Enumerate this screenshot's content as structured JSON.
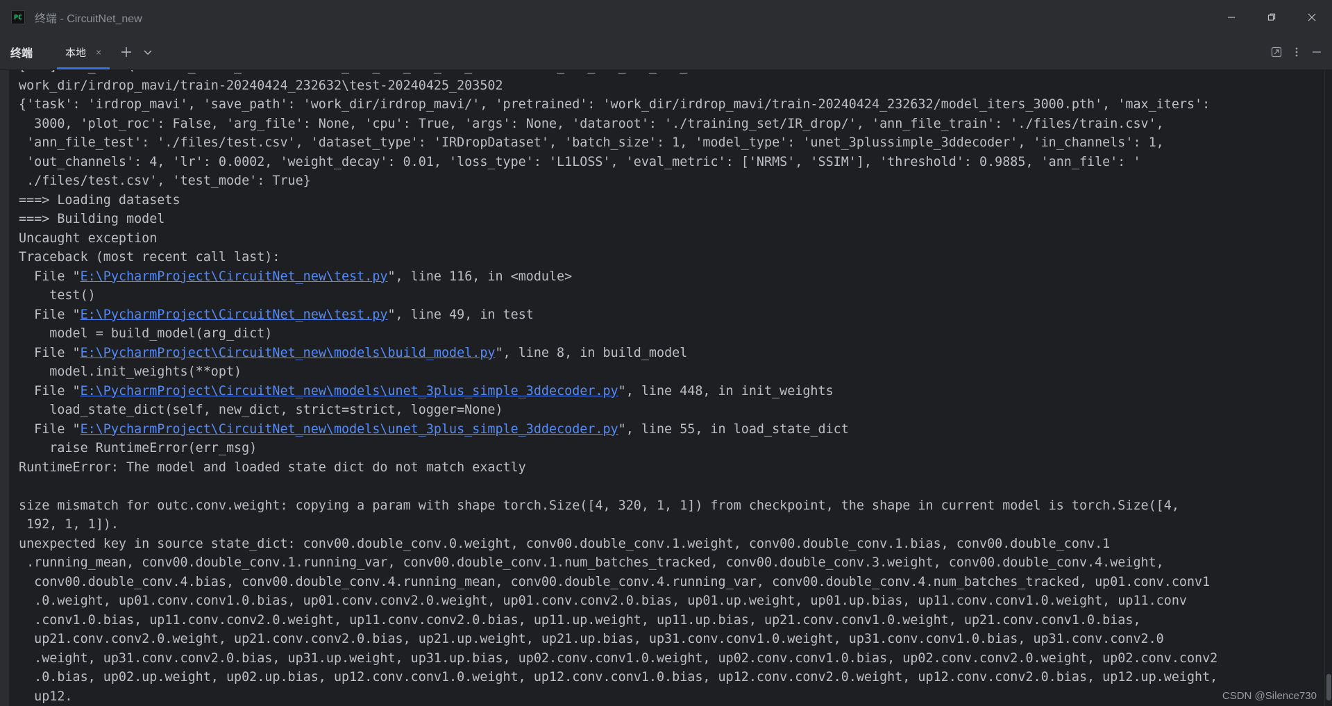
{
  "window": {
    "logo_text": "PC",
    "title": "终端 - CircuitNet_new",
    "icons": [
      "minimize-icon",
      "restore-icon",
      "close-icon"
    ]
  },
  "toolbar": {
    "panel_title": "终端",
    "tab_label": "本地",
    "tab_close": "×",
    "add_icon": "plus-icon",
    "dropdown_icon": "chevron-down-icon",
    "tools": [
      "expand-icon",
      "more-icon",
      "hide-icon"
    ]
  },
  "terminal": {
    "lines": [
      {
        "text": "[...] ..._... \\...-..._... 2_...  ...  ..._..._..._.. _..._.. ...  ..._..._..._..._..._.."
      },
      {
        "text": "work_dir/irdrop_mavi/train-20240424_232632\\test-20240425_203502"
      },
      {
        "text": "{'task': 'irdrop_mavi', 'save_path': 'work_dir/irdrop_mavi/', 'pretrained': 'work_dir/irdrop_mavi/train-20240424_232632/model_iters_3000.pth', 'max_iters':"
      },
      {
        "text": "  3000, 'plot_roc': False, 'arg_file': None, 'cpu': True, 'args': None, 'dataroot': './training_set/IR_drop/', 'ann_file_train': './files/train.csv',"
      },
      {
        "text": " 'ann_file_test': './files/test.csv', 'dataset_type': 'IRDropDataset', 'batch_size': 1, 'model_type': 'unet_3plussimple_3ddecoder', 'in_channels': 1,"
      },
      {
        "text": " 'out_channels': 4, 'lr': 0.0002, 'weight_decay': 0.01, 'loss_type': 'L1LOSS', 'eval_metric': ['NRMS', 'SSIM'], 'threshold': 0.9885, 'ann_file': '"
      },
      {
        "text": " ./files/test.csv', 'test_mode': True}"
      },
      {
        "text": "===> Loading datasets"
      },
      {
        "text": "===> Building model"
      },
      {
        "text": "Uncaught exception"
      },
      {
        "text": "Traceback (most recent call last):"
      },
      {
        "pre": "  File \"",
        "link": "E:\\PycharmProject\\CircuitNet_new\\test.py",
        "post": "\", line 116, in <module>"
      },
      {
        "text": "    test()"
      },
      {
        "pre": "  File \"",
        "link": "E:\\PycharmProject\\CircuitNet_new\\test.py",
        "post": "\", line 49, in test"
      },
      {
        "text": "    model = build_model(arg_dict)"
      },
      {
        "pre": "  File \"",
        "link": "E:\\PycharmProject\\CircuitNet_new\\models\\build_model.py",
        "post": "\", line 8, in build_model"
      },
      {
        "text": "    model.init_weights(**opt)"
      },
      {
        "pre": "  File \"",
        "link": "E:\\PycharmProject\\CircuitNet_new\\models\\unet_3plus_simple_3ddecoder.py",
        "post": "\", line 448, in init_weights"
      },
      {
        "text": "    load_state_dict(self, new_dict, strict=strict, logger=None)"
      },
      {
        "pre": "  File \"",
        "link": "E:\\PycharmProject\\CircuitNet_new\\models\\unet_3plus_simple_3ddecoder.py",
        "post": "\", line 55, in load_state_dict"
      },
      {
        "text": "    raise RuntimeError(err_msg)"
      },
      {
        "text": "RuntimeError: The model and loaded state dict do not match exactly"
      },
      {
        "text": ""
      },
      {
        "text": "size mismatch for outc.conv.weight: copying a param with shape torch.Size([4, 320, 1, 1]) from checkpoint, the shape in current model is torch.Size([4,"
      },
      {
        "text": " 192, 1, 1])."
      },
      {
        "text": "unexpected key in source state_dict: conv00.double_conv.0.weight, conv00.double_conv.1.weight, conv00.double_conv.1.bias, conv00.double_conv.1"
      },
      {
        "text": " .running_mean, conv00.double_conv.1.running_var, conv00.double_conv.1.num_batches_tracked, conv00.double_conv.3.weight, conv00.double_conv.4.weight,"
      },
      {
        "text": "  conv00.double_conv.4.bias, conv00.double_conv.4.running_mean, conv00.double_conv.4.running_var, conv00.double_conv.4.num_batches_tracked, up01.conv.conv1"
      },
      {
        "text": "  .0.weight, up01.conv.conv1.0.bias, up01.conv.conv2.0.weight, up01.conv.conv2.0.bias, up01.up.weight, up01.up.bias, up11.conv.conv1.0.weight, up11.conv"
      },
      {
        "text": "  .conv1.0.bias, up11.conv.conv2.0.weight, up11.conv.conv2.0.bias, up11.up.weight, up11.up.bias, up21.conv.conv1.0.weight, up21.conv.conv1.0.bias,"
      },
      {
        "text": "  up21.conv.conv2.0.weight, up21.conv.conv2.0.bias, up21.up.weight, up21.up.bias, up31.conv.conv1.0.weight, up31.conv.conv1.0.bias, up31.conv.conv2.0"
      },
      {
        "text": "  .weight, up31.conv.conv2.0.bias, up31.up.weight, up31.up.bias, up02.conv.conv1.0.weight, up02.conv.conv1.0.bias, up02.conv.conv2.0.weight, up02.conv.conv2"
      },
      {
        "text": "  .0.bias, up02.up.weight, up02.up.bias, up12.conv.conv1.0.weight, up12.conv.conv1.0.bias, up12.conv.conv2.0.weight, up12.conv.conv2.0.bias, up12.up.weight,"
      },
      {
        "text": "  up12."
      }
    ]
  },
  "watermark": "CSDN @Silence730",
  "colors": {
    "background": "#1e1f22",
    "chrome": "#2b2d30",
    "text": "#bcbec4",
    "link": "#548af7",
    "tab_underline": "#3574f0"
  }
}
